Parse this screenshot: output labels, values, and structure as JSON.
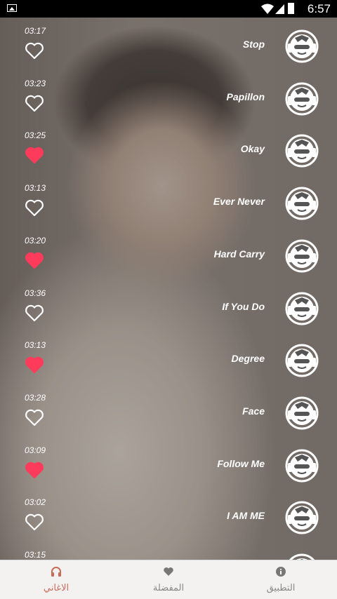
{
  "status_bar": {
    "time": "6:57"
  },
  "songs": [
    {
      "title": "Stop",
      "duration": "03:17",
      "favorite": false
    },
    {
      "title": "Papillon",
      "duration": "03:23",
      "favorite": false
    },
    {
      "title": "Okay",
      "duration": "03:25",
      "favorite": true
    },
    {
      "title": "Ever Never",
      "duration": "03:13",
      "favorite": false
    },
    {
      "title": "Hard Carry",
      "duration": "03:20",
      "favorite": true
    },
    {
      "title": "If You Do",
      "duration": "03:36",
      "favorite": false
    },
    {
      "title": "Degree",
      "duration": "03:13",
      "favorite": true
    },
    {
      "title": "Face",
      "duration": "03:28",
      "favorite": false
    },
    {
      "title": "Follow Me",
      "duration": "03:09",
      "favorite": true
    },
    {
      "title": "I AM ME",
      "duration": "03:02",
      "favorite": false
    },
    {
      "title": "",
      "duration": "03:15",
      "favorite": false
    }
  ],
  "bottom_nav": {
    "songs": "الاغاني",
    "favorites": "المفضلة",
    "app": "التطبيق"
  },
  "colors": {
    "heart_active": "#ff3b5c",
    "tab_active": "#c96a5a"
  }
}
